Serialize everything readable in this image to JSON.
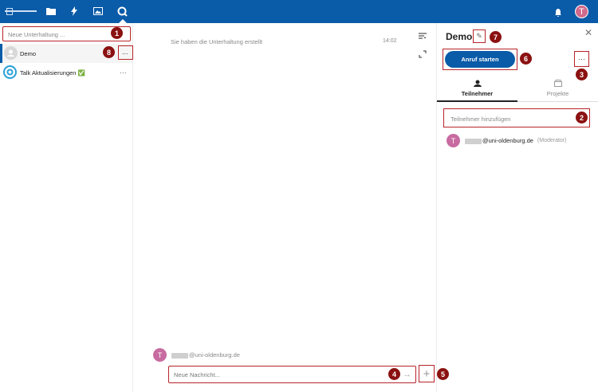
{
  "topbar": {
    "apps": [
      "files-icon",
      "activity-icon",
      "gallery-icon",
      "talk-icon"
    ],
    "user_initial": "T"
  },
  "sidebar": {
    "search_placeholder": "Neue Unterhaltung ...",
    "conversations": [
      {
        "label": "Demo",
        "more": "..."
      },
      {
        "label": "Talk Aktualisierungen ✅",
        "more": "..."
      }
    ]
  },
  "chat": {
    "system_message": "Sie haben die Unterhaltung erstellt",
    "system_time": "14:02",
    "author_initial": "T",
    "author_name": "@uni-oldenburg.de",
    "input_placeholder": "Neue Nachricht...",
    "send_icon": "→",
    "attach_icon": "+"
  },
  "room": {
    "title": "Demo",
    "edit_icon": "✎",
    "close_icon": "✕",
    "call_label": "Anruf starten",
    "more_label": "···",
    "tabs": [
      {
        "label": "Teilnehmer",
        "icon": "participants-icon",
        "active": true
      },
      {
        "label": "Projekte",
        "icon": "projects-icon",
        "active": false
      }
    ],
    "participant_placeholder": "Teilnehmer hinzufügen",
    "participant": {
      "initial": "T",
      "name": "@uni-oldenburg.de",
      "role": "(Moderator)"
    }
  },
  "markers": [
    "1",
    "2",
    "3",
    "4",
    "5",
    "6",
    "7",
    "8"
  ],
  "colors": {
    "brand": "#0a5ba8",
    "marker": "#8b1111",
    "highlight": "#b8242a"
  }
}
